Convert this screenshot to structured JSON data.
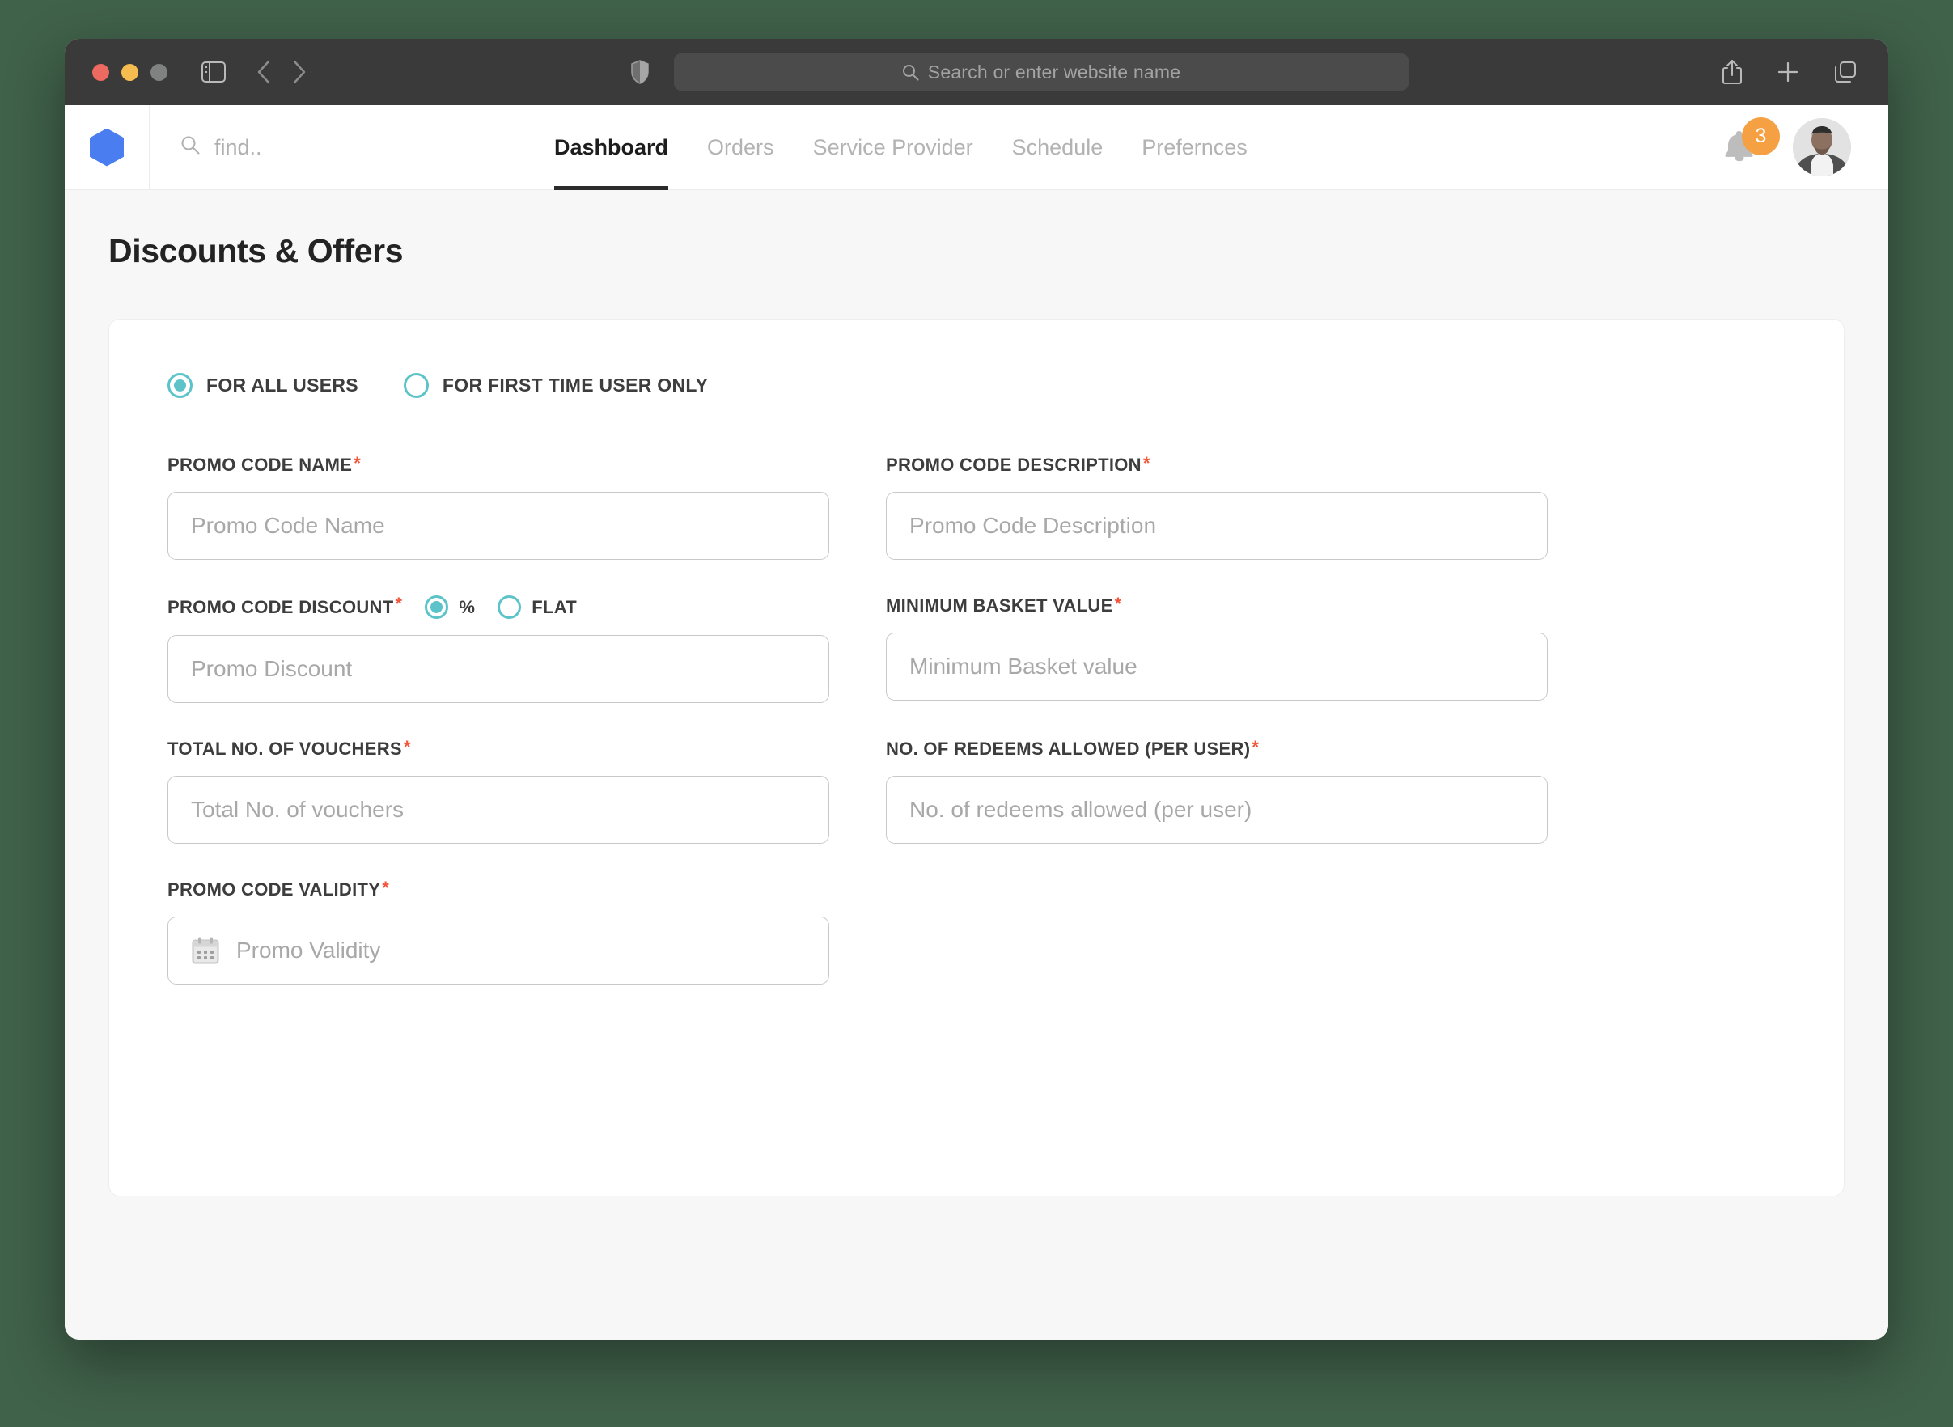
{
  "browser": {
    "traffic_lights": [
      "close",
      "minimize",
      "maximize"
    ],
    "address_placeholder": "Search or enter website name",
    "icons": {
      "sidebar": "sidebar-toggle-icon",
      "back": "back-arrow-icon",
      "forward": "forward-arrow-icon",
      "shield": "shield-icon",
      "share": "share-icon",
      "new_tab": "plus-icon",
      "tabs": "tab-overview-icon"
    }
  },
  "app": {
    "logo": "hexagon-logo",
    "search_placeholder": "find..",
    "nav": [
      {
        "label": "Dashboard",
        "active": true
      },
      {
        "label": "Orders",
        "active": false
      },
      {
        "label": "Service Provider",
        "active": false
      },
      {
        "label": "Schedule",
        "active": false
      },
      {
        "label": "Prefernces",
        "active": false
      }
    ],
    "notifications": {
      "count": "3",
      "badge_color": "#f4a043"
    },
    "avatar_alt": "user-avatar"
  },
  "page": {
    "title": "Discounts & Offers"
  },
  "form": {
    "accent_color": "#5cc3c8",
    "required_color": "#f4563c",
    "audience_radios": [
      {
        "label": "FOR ALL USERS",
        "checked": true
      },
      {
        "label": "FOR FIRST TIME USER ONLY",
        "checked": false
      }
    ],
    "discount_type_radios": [
      {
        "label": "%",
        "checked": true
      },
      {
        "label": "FLAT",
        "checked": false
      }
    ],
    "fields": {
      "promo_code_name": {
        "label": "PROMO CODE NAME",
        "required": "*",
        "placeholder": "Promo Code Name",
        "value": ""
      },
      "promo_code_description": {
        "label": "PROMO CODE DESCRIPTION",
        "required": "*",
        "placeholder": "Promo Code Description",
        "value": ""
      },
      "promo_code_discount": {
        "label": "PROMO CODE DISCOUNT",
        "required": "*",
        "placeholder": "Promo Discount",
        "value": ""
      },
      "minimum_basket_value": {
        "label": "MINIMUM BASKET VALUE",
        "required": "*",
        "placeholder": "Minimum Basket value",
        "value": ""
      },
      "total_no_of_vouchers": {
        "label": "TOTAL NO. OF VOUCHERS",
        "required": "*",
        "placeholder": "Total No. of vouchers",
        "value": ""
      },
      "no_of_redeems_allowed": {
        "label": "NO. OF REDEEMS ALLOWED (PER USER)",
        "required": "*",
        "placeholder": "No. of redeems allowed (per user)",
        "value": ""
      },
      "promo_code_validity": {
        "label": "PROMO CODE VALIDITY",
        "required": "*",
        "placeholder": "Promo Validity",
        "value": "",
        "icon": "calendar-icon"
      }
    }
  }
}
